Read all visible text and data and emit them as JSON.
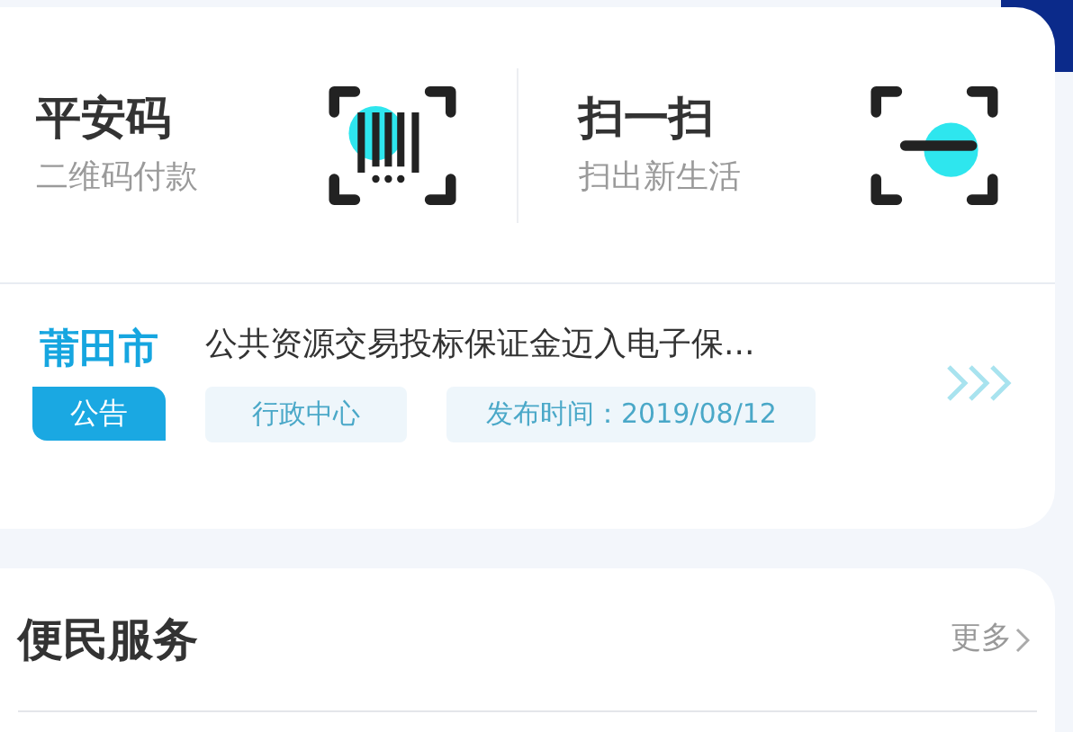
{
  "quick_actions": [
    {
      "kind": "barcode",
      "title": "平安码",
      "subtitle": "二维码付款"
    },
    {
      "kind": "scan",
      "title": "扫一扫",
      "subtitle": "扫出新生活"
    }
  ],
  "notice": {
    "city": "莆田市",
    "badge": "公告",
    "title": "公共资源交易投标保证金迈入电子保...",
    "tags": [
      "行政中心",
      "发布时间：2019/08/12"
    ]
  },
  "services": {
    "title": "便民服务",
    "more": "更多"
  }
}
